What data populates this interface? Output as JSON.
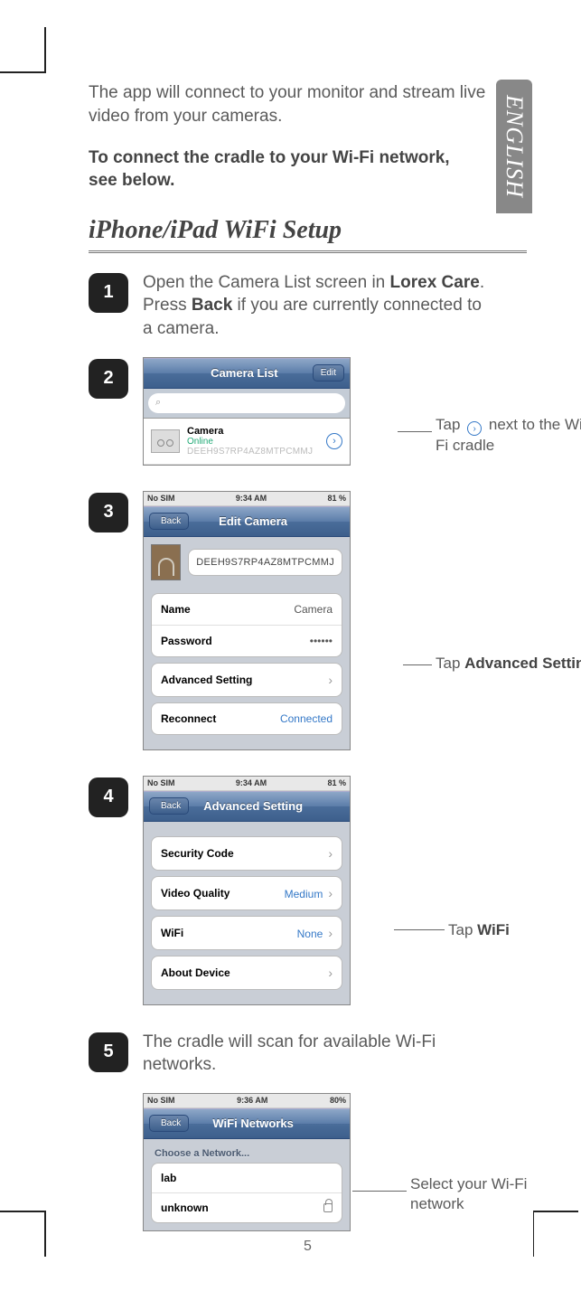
{
  "language_tab": "ENGLISH",
  "intro": "The app will connect to your monitor and stream live video from your cameras.",
  "subhead": "To connect the cradle to your Wi-Fi network, see below.",
  "section_title": "iPhone/iPad WiFi Setup",
  "page_number": "5",
  "steps": {
    "s1": {
      "num": "1",
      "text_pre": "Open the Camera List screen in ",
      "b1": "Lorex Care",
      "mid": ". Press ",
      "b2": "Back",
      "post": " if you are currently connected to a camera."
    },
    "s2": {
      "num": "2"
    },
    "s3": {
      "num": "3"
    },
    "s4": {
      "num": "4"
    },
    "s5": {
      "num": "5",
      "text": "The cradle will scan for available Wi-Fi networks."
    }
  },
  "annotations": {
    "a2_pre": "Tap ",
    "a2_post": " next to the Wi-Fi cradle",
    "a3_pre": "Tap ",
    "a3_b": "Advanced Setting",
    "a4_pre": "Tap ",
    "a4_b": "WiFi",
    "a5": "Select your Wi-Fi network"
  },
  "shot2": {
    "nav_title": "Camera List",
    "nav_edit": "Edit",
    "search_icon": "⌕",
    "camera_name": "Camera",
    "camera_status": "Online",
    "camera_id": "DEEH9S7RP4AZ8MTPCMMJ"
  },
  "shot3": {
    "status_left": "No SIM",
    "status_time": "9:34 AM",
    "status_batt": "81 %",
    "back": "Back",
    "nav_title": "Edit Camera",
    "device_id": "DEEH9S7RP4AZ8MTPCMMJ",
    "name_lbl": "Name",
    "name_val": "Camera",
    "pass_lbl": "Password",
    "pass_val": "••••••",
    "adv_lbl": "Advanced Setting",
    "reconnect_lbl": "Reconnect",
    "reconnect_val": "Connected"
  },
  "shot4": {
    "status_left": "No SIM",
    "status_time": "9:34 AM",
    "status_batt": "81 %",
    "back": "Back",
    "nav_title": "Advanced Setting",
    "sec_lbl": "Security Code",
    "vq_lbl": "Video Quality",
    "vq_val": "Medium",
    "wifi_lbl": "WiFi",
    "wifi_val": "None",
    "about_lbl": "About Device"
  },
  "shot5": {
    "status_left": "No SIM",
    "status_time": "9:36 AM",
    "status_batt": "80%",
    "back": "Back",
    "nav_title": "WiFi Networks",
    "choose": "Choose a Network...",
    "net1": "lab",
    "net2": "unknown"
  }
}
